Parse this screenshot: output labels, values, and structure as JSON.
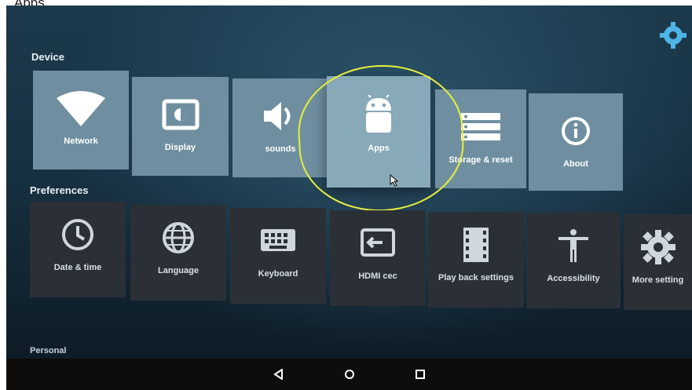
{
  "photo_caption": "Apps",
  "sections": {
    "device": "Device",
    "preferences": "Preferences",
    "personal": "Personal"
  },
  "device_tiles": [
    {
      "label": "Network",
      "icon": "wifi-icon"
    },
    {
      "label": "Display",
      "icon": "display-icon"
    },
    {
      "label": "sounds",
      "icon": "speaker-icon"
    },
    {
      "label": "Apps",
      "icon": "android-icon"
    },
    {
      "label": "Storage & reset",
      "icon": "storage-icon"
    },
    {
      "label": "About",
      "icon": "info-icon"
    }
  ],
  "preference_tiles": [
    {
      "label": "Date & time",
      "icon": "clock-icon"
    },
    {
      "label": "Language",
      "icon": "globe-icon"
    },
    {
      "label": "Keyboard",
      "icon": "keyboard-icon"
    },
    {
      "label": "HDMI cec",
      "icon": "input-icon"
    },
    {
      "label": "Play back settings",
      "icon": "film-icon"
    },
    {
      "label": "Accessibility",
      "icon": "accessibility-icon"
    },
    {
      "label": "More setting",
      "icon": "gear-icon"
    }
  ],
  "colors": {
    "device_tile": "#6f8fa0",
    "selected_tile": "#88a9b8",
    "pref_tile": "#2a3036",
    "highlight": "#e8ef3a"
  }
}
